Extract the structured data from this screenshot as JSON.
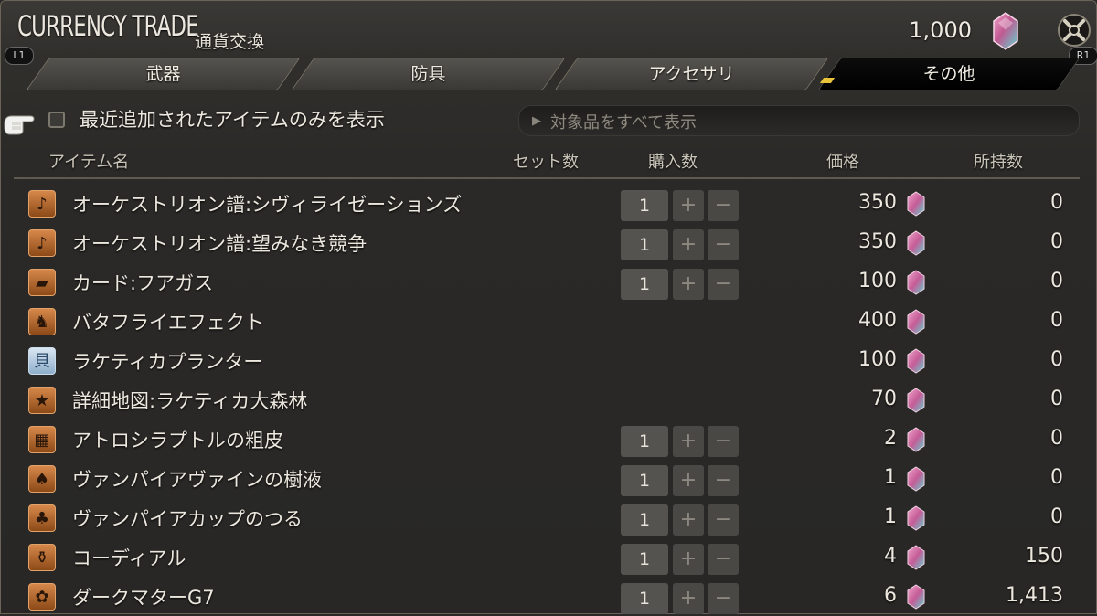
{
  "header": {
    "title": "CURRENCY TRADE",
    "subtitle": "通貨交換",
    "currency_amount": "1,000",
    "left_button_tag": "L1",
    "right_button_tag": "R1"
  },
  "tabs": [
    {
      "label": "武器",
      "active": false
    },
    {
      "label": "防具",
      "active": false
    },
    {
      "label": "アクセサリ",
      "active": false
    },
    {
      "label": "その他",
      "active": true
    }
  ],
  "filter": {
    "checkbox_label": "最近追加されたアイテムのみを表示",
    "checkbox_checked": false,
    "dropdown_value": "対象品をすべて表示"
  },
  "columns": {
    "name": "アイテム名",
    "set_count": "セット数",
    "purchase_count": "購入数",
    "price": "価格",
    "owned": "所持数"
  },
  "items": [
    {
      "name": "オーケストリオン譜:シヴィライゼーションズ",
      "icon": "music-note-icon",
      "qty": "1",
      "has_qty": true,
      "price": "350",
      "owned": "0"
    },
    {
      "name": "オーケストリオン譜:望みなき競争",
      "icon": "music-note-icon",
      "qty": "1",
      "has_qty": true,
      "price": "350",
      "owned": "0"
    },
    {
      "name": "カード:フアガス",
      "icon": "card-icon",
      "qty": "1",
      "has_qty": true,
      "price": "100",
      "owned": "0"
    },
    {
      "name": "バタフライエフェクト",
      "icon": "emote-icon",
      "qty": "",
      "has_qty": false,
      "price": "400",
      "owned": "0"
    },
    {
      "name": "ラケティカプランター",
      "icon": "furnishing-icon",
      "qty": "",
      "has_qty": false,
      "price": "100",
      "owned": "0"
    },
    {
      "name": "詳細地図:ラケティカ大森林",
      "icon": "star-map-icon",
      "qty": "",
      "has_qty": false,
      "price": "70",
      "owned": "0"
    },
    {
      "name": "アトロシラプトルの粗皮",
      "icon": "leather-icon",
      "qty": "1",
      "has_qty": true,
      "price": "2",
      "owned": "0"
    },
    {
      "name": "ヴァンパイアヴァインの樹液",
      "icon": "sap-icon",
      "qty": "1",
      "has_qty": true,
      "price": "1",
      "owned": "0"
    },
    {
      "name": "ヴァンパイアカップのつる",
      "icon": "vine-icon",
      "qty": "1",
      "has_qty": true,
      "price": "1",
      "owned": "0"
    },
    {
      "name": "コーディアル",
      "icon": "potion-icon",
      "qty": "1",
      "has_qty": true,
      "price": "4",
      "owned": "150"
    },
    {
      "name": "ダークマターG7",
      "icon": "dark-matter-icon",
      "qty": "1",
      "has_qty": true,
      "price": "6",
      "owned": "1,413"
    }
  ],
  "colors": {
    "gem_pink": "#e07ab0",
    "gem_teal": "#5fd6d0",
    "icon_orange": "#d6884a"
  }
}
